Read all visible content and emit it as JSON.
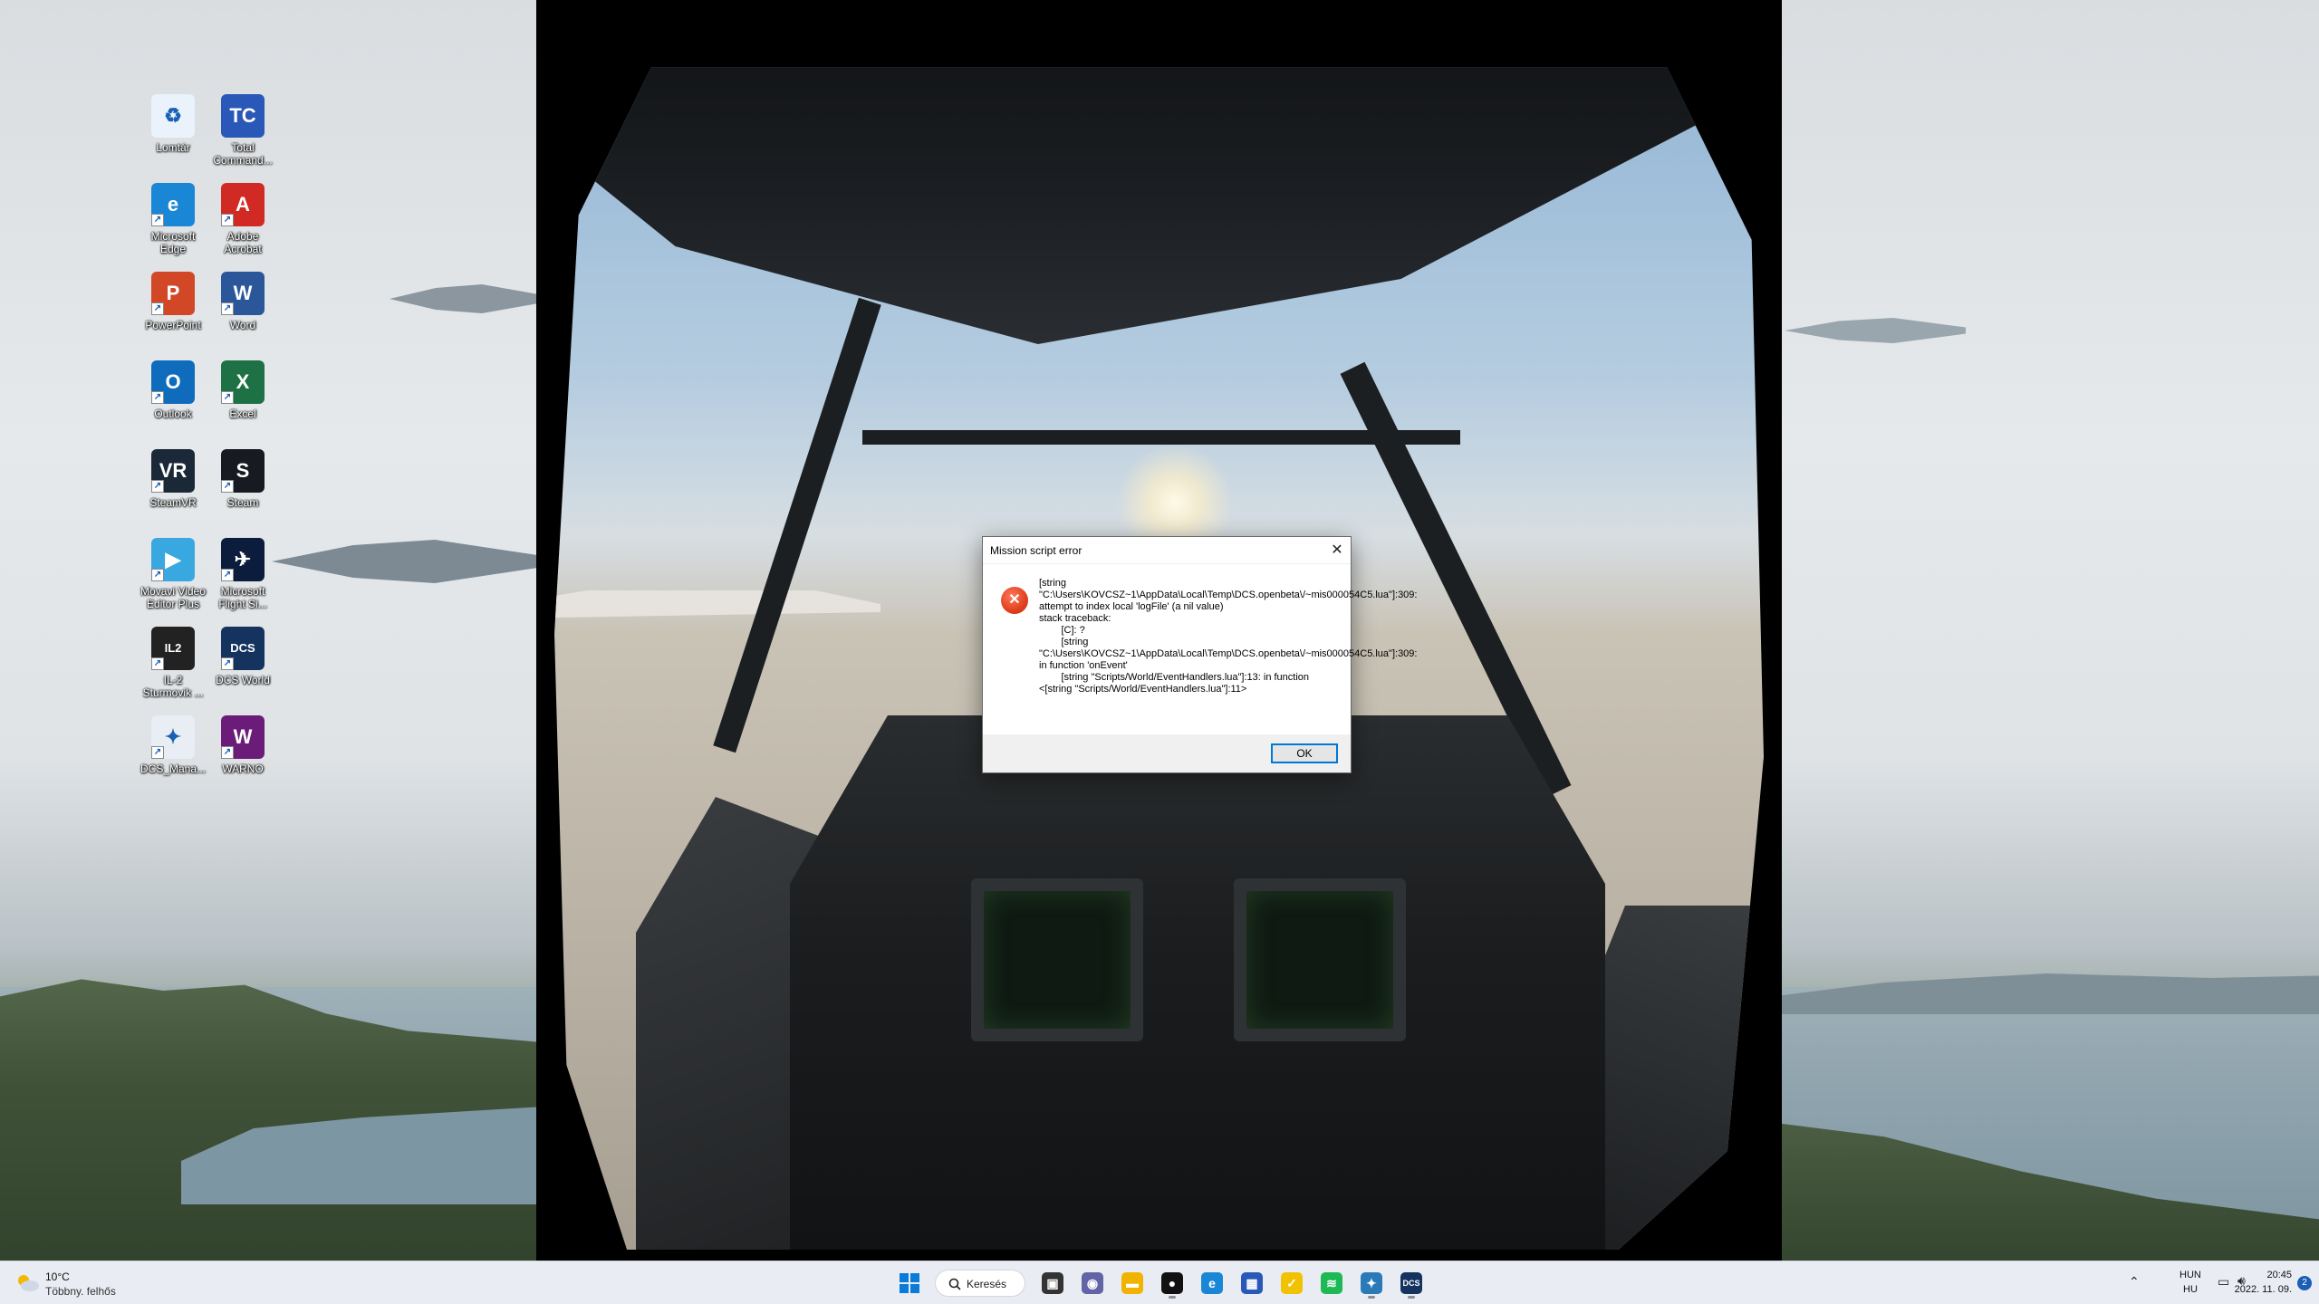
{
  "desktop": {
    "icons": [
      {
        "label": "Lomtár",
        "glyph": "♻",
        "color": "#eaf3fb",
        "icon": "recycle-bin-icon",
        "shortcut": false
      },
      {
        "label": "Total Command...",
        "glyph": "TC",
        "color": "#2a58b8",
        "icon": "floppy-disk-icon",
        "shortcut": false
      },
      {
        "label": "Microsoft Edge",
        "glyph": "e",
        "color": "#1a86d6",
        "icon": "edge-browser-icon",
        "shortcut": true
      },
      {
        "label": "Adobe Acrobat",
        "glyph": "A",
        "color": "#d12a24",
        "icon": "pdf-icon",
        "shortcut": true
      },
      {
        "label": "PowerPoint",
        "glyph": "P",
        "color": "#d24726",
        "icon": "powerpoint-icon",
        "shortcut": true
      },
      {
        "label": "Word",
        "glyph": "W",
        "color": "#2b579a",
        "icon": "word-icon",
        "shortcut": true
      },
      {
        "label": "Outlook",
        "glyph": "O",
        "color": "#0f6cbd",
        "icon": "outlook-icon",
        "shortcut": true
      },
      {
        "label": "Excel",
        "glyph": "X",
        "color": "#1e7145",
        "icon": "excel-icon",
        "shortcut": true
      },
      {
        "label": "SteamVR",
        "glyph": "VR",
        "color": "#1b2838",
        "icon": "steamvr-icon",
        "shortcut": true
      },
      {
        "label": "Steam",
        "glyph": "S",
        "color": "#171a21",
        "icon": "steam-icon",
        "shortcut": true
      },
      {
        "label": "Movavi Video Editor Plus",
        "glyph": "▶",
        "color": "#3aa8e0",
        "icon": "video-editor-icon",
        "shortcut": true
      },
      {
        "label": "Microsoft Flight Si...",
        "glyph": "✈",
        "color": "#0b1c3d",
        "icon": "flight-simulator-icon",
        "shortcut": true
      },
      {
        "label": "IL-2 Sturmovik ...",
        "glyph": "IL2",
        "color": "#222222",
        "icon": "il2-icon",
        "shortcut": true
      },
      {
        "label": "DCS World",
        "glyph": "DCS",
        "color": "#14335e",
        "icon": "dcs-world-icon",
        "shortcut": true
      },
      {
        "label": "DCS_Mana...",
        "glyph": "✦",
        "color": "#e9eef4",
        "icon": "dcs-manager-icon",
        "shortcut": true
      },
      {
        "label": "WARNO",
        "glyph": "W",
        "color": "#6b1b78",
        "icon": "warno-icon",
        "shortcut": true
      }
    ]
  },
  "dialog": {
    "title": "Mission script error",
    "message": "[string \"C:\\Users\\KOVCSZ~1\\AppData\\Local\\Temp\\DCS.openbeta\\/~mis000054C5.lua\"]:309: attempt to index local 'logFile' (a nil value)\nstack traceback:\n\t[C]: ?\n\t[string \"C:\\Users\\KOVCSZ~1\\AppData\\Local\\Temp\\DCS.openbeta\\/~mis000054C5.lua\"]:309: in function 'onEvent'\n\t[string \"Scripts/World/EventHandlers.lua\"]:13: in function <[string \"Scripts/World/EventHandlers.lua\"]:11>",
    "ok_label": "OK",
    "close_glyph": "✕",
    "error_glyph": "✕"
  },
  "taskbar": {
    "weather": {
      "temp": "10°C",
      "desc": "Többny. felhős"
    },
    "search_label": "Keresés",
    "apps": [
      {
        "name": "start-button",
        "glyph": "⊞",
        "color": "#0078d4"
      },
      {
        "name": "search-icon-button",
        "glyph": "",
        "color": "#222"
      },
      {
        "name": "task-view-button",
        "glyph": "▣",
        "color": "#333"
      },
      {
        "name": "teams-chat-button",
        "glyph": "◉",
        "color": "#6264a7"
      },
      {
        "name": "file-explorer-button",
        "glyph": "▬",
        "color": "#f0b400"
      },
      {
        "name": "media-app-button",
        "glyph": "●",
        "color": "#111"
      },
      {
        "name": "edge-taskbar-button",
        "glyph": "e",
        "color": "#1a86d6"
      },
      {
        "name": "store-taskbar-button",
        "glyph": "▦",
        "color": "#2a58b8"
      },
      {
        "name": "norton-taskbar-button",
        "glyph": "✓",
        "color": "#f2c200"
      },
      {
        "name": "spotify-taskbar-button",
        "glyph": "≋",
        "color": "#1db954"
      },
      {
        "name": "dcs-manager-taskbar-button",
        "glyph": "✦",
        "color": "#2a7ab8"
      },
      {
        "name": "dcs-world-taskbar-button",
        "glyph": "DCS",
        "color": "#14335e"
      }
    ],
    "tray": {
      "lang_top": "HUN",
      "lang_bottom": "HU",
      "time": "20:45",
      "date": "2022. 11. 09.",
      "notifications": "2"
    }
  }
}
